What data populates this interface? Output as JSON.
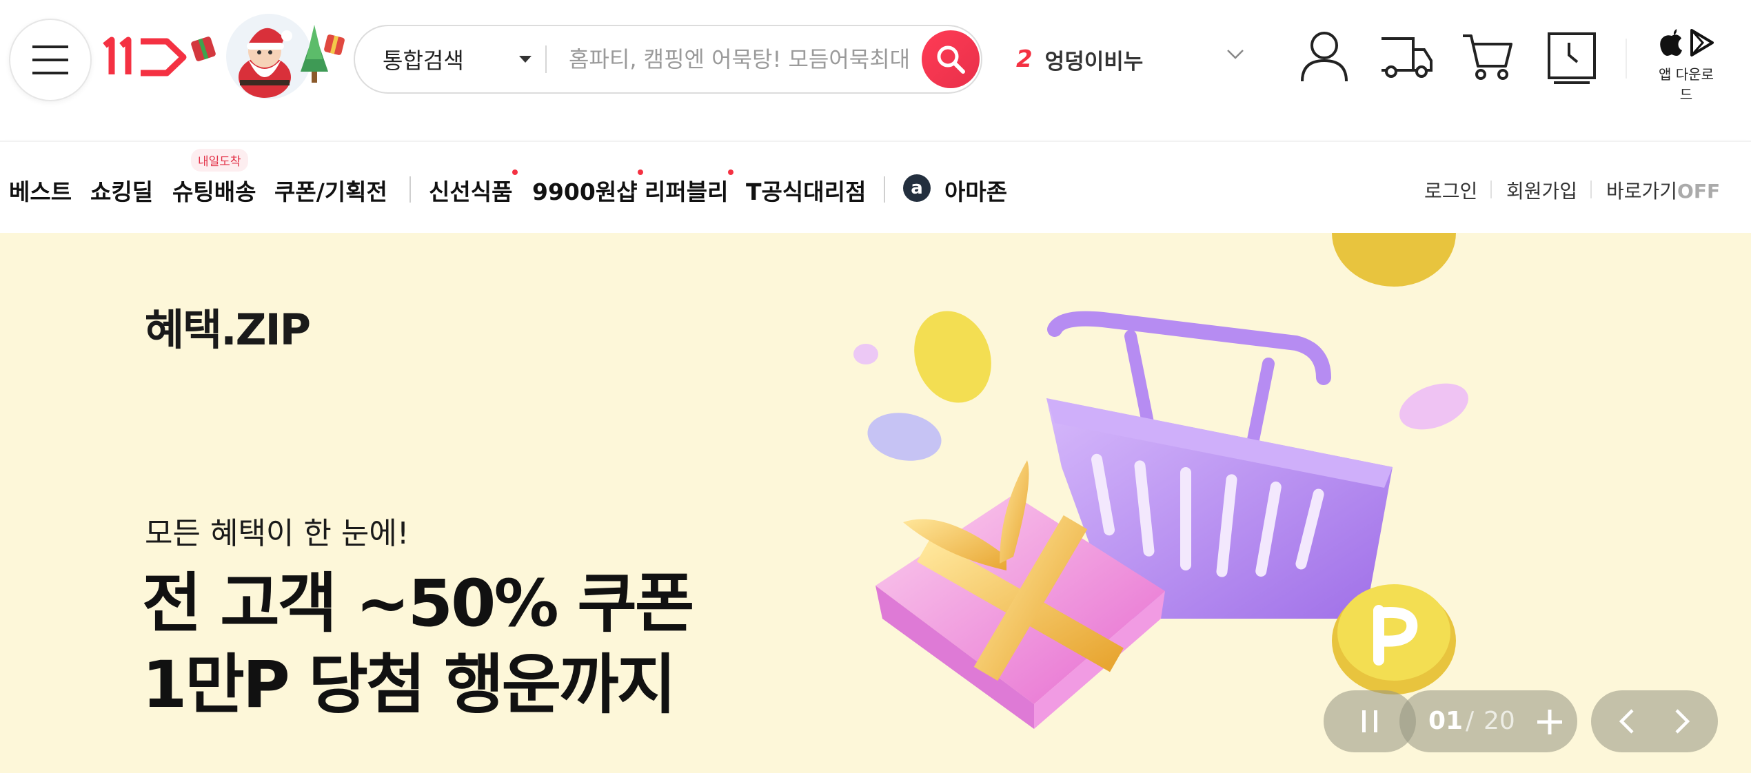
{
  "header": {
    "search": {
      "category": "통합검색",
      "placeholder": "홈파티, 캠핑엔 어묵탕! 모듬어묵최대"
    },
    "ranking": {
      "number": "2",
      "keyword": "엉덩이비누"
    },
    "app_download_label": "앱 다운로드",
    "icons": [
      "menu-icon",
      "user-icon",
      "truck-icon",
      "cart-icon",
      "recent-icon",
      "apple-icon",
      "play-store-icon",
      "search-icon"
    ]
  },
  "gnb": {
    "items": [
      "베스트",
      "쇼킹딜",
      "슈팅배송",
      "쿠폰/기획전",
      "신선식품",
      "9900원샵",
      "리퍼블리",
      "T공식대리점",
      "아마존"
    ],
    "badge": "내일도착",
    "amazon_letter": "a",
    "util": {
      "login": "로그인",
      "signup": "회원가입",
      "shortcut": "바로가기",
      "shortcut_state": "OFF"
    }
  },
  "banner": {
    "logo": "혜택.ZIP",
    "subtitle": "모든 혜택이 한 눈에!",
    "title_line1": "전 고객 ~50% 쿠폰",
    "title_line2": "1만P 당첨 행운까지",
    "pager": {
      "current": "01",
      "separator": "/",
      "total": "20"
    }
  },
  "colors": {
    "brand_red": "#f43142",
    "banner_bg": "#fdf7d9",
    "basket_purple": "#b98cf2",
    "gift_pink": "#f39ad8",
    "coin_yellow": "#f3de52"
  }
}
